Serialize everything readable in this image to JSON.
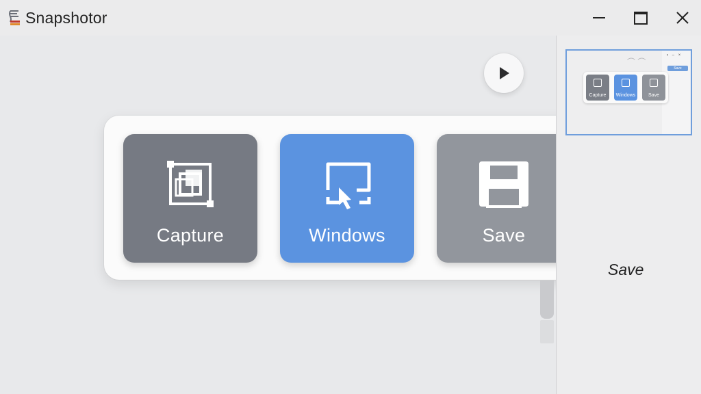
{
  "app": {
    "title": "Snapshotor",
    "icon": "app-logo-icon"
  },
  "window_controls": {
    "minimize": "minimize-icon",
    "maximize": "maximize-icon",
    "close": "close-icon"
  },
  "toolbar": {
    "play_icon": "play-icon"
  },
  "actions": [
    {
      "label": "Capture",
      "icon": "capture-icon",
      "color": "#767a83"
    },
    {
      "label": "Windows",
      "icon": "window-select-icon",
      "color": "#5b93e0",
      "active": true
    },
    {
      "label": "Save",
      "icon": "save-icon",
      "color": "#92969d"
    }
  ],
  "preview": {
    "tiles": [
      "Capture",
      "Windows",
      "Save"
    ],
    "button": "Save"
  },
  "sidepane": {
    "label": "Save"
  },
  "colors": {
    "accent": "#5b93e0",
    "thumb_border": "#6f9edc"
  }
}
